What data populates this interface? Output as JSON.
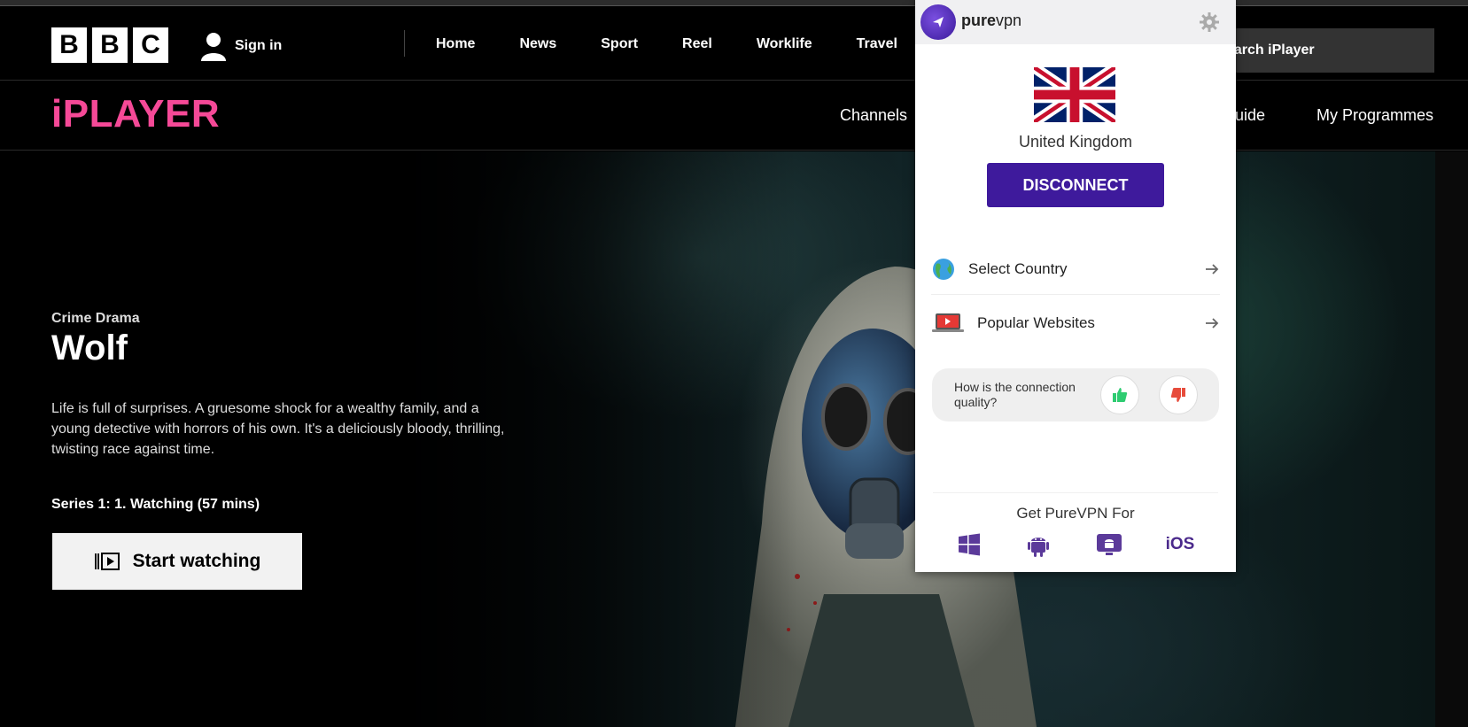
{
  "bbc": {
    "logo_letters": [
      "B",
      "B",
      "C"
    ],
    "signin_label": "Sign in",
    "nav": [
      "Home",
      "News",
      "Sport",
      "Reel",
      "Worklife",
      "Travel"
    ],
    "search_placeholder": "earch iPlayer"
  },
  "iplayer": {
    "logo": "iPLAYER",
    "nav": {
      "channels": "Channels",
      "guide": "uide",
      "my_programmes": "My Programmes"
    }
  },
  "hero": {
    "genre": "Crime Drama",
    "title": "Wolf",
    "synopsis": "Life is full of surprises. A gruesome shock for a wealthy family, and a young detective with horrors of his own. It's a deliciously bloody, thrilling, twisting race against time.",
    "episode": "Series 1: 1. Watching (57 mins)",
    "cta": "Start watching"
  },
  "vpn": {
    "brand_bold": "pure",
    "brand_light": "vpn",
    "country": "United Kingdom",
    "disconnect": "DISCONNECT",
    "rows": [
      {
        "label": "Select Country",
        "icon": "globe-icon"
      },
      {
        "label": "Popular Websites",
        "icon": "laptop-video-icon"
      }
    ],
    "feedback_question": "How is the connection quality?",
    "get_label": "Get PureVPN For",
    "platforms": [
      "windows-icon",
      "android-icon",
      "android-tv-icon",
      "iOS"
    ],
    "colors": {
      "accent": "#3e1a9c",
      "iplayer_pink": "#f54997",
      "thumbs_up": "#2ecc71",
      "thumbs_down": "#e74c3c"
    }
  }
}
